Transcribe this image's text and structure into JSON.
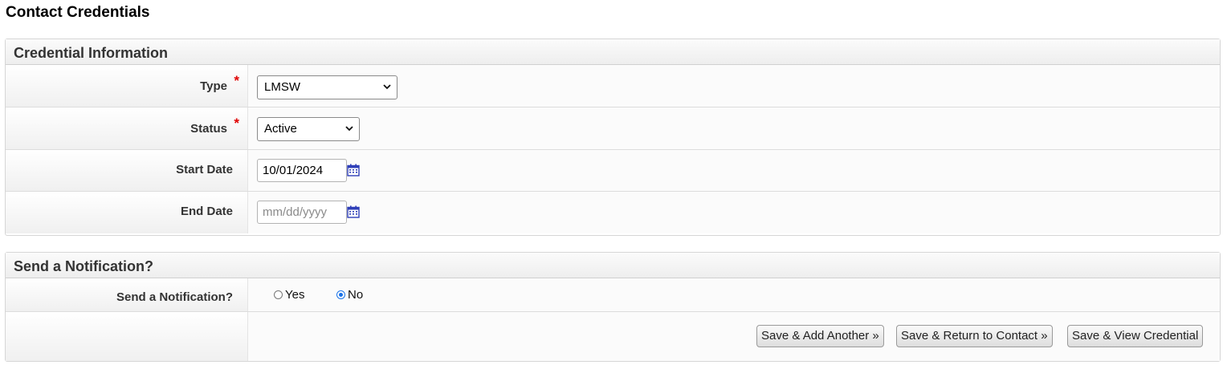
{
  "page_title": "Contact Credentials",
  "credential_panel": {
    "title": "Credential Information",
    "type": {
      "label": "Type",
      "required_mark": "*",
      "value": "LMSW"
    },
    "status": {
      "label": "Status",
      "required_mark": "*",
      "value": "Active"
    },
    "start_date": {
      "label": "Start Date",
      "value": "10/01/2024",
      "placeholder": "mm/dd/yyyy"
    },
    "end_date": {
      "label": "End Date",
      "value": "",
      "placeholder": "mm/dd/yyyy"
    }
  },
  "notification_panel": {
    "title": "Send a Notification?",
    "question_label": "Send a Notification?",
    "options": [
      {
        "label": "Yes",
        "checked": false
      },
      {
        "label": "No",
        "checked": true
      }
    ]
  },
  "actions": {
    "save_add_another": "Save & Add Another »",
    "save_return": "Save & Return to Contact »",
    "save_view": "Save & View Credential"
  },
  "colors": {
    "required": "#e00000",
    "calendar_icon": "#2f3fb8",
    "radio_checked": "#1a73e8"
  }
}
